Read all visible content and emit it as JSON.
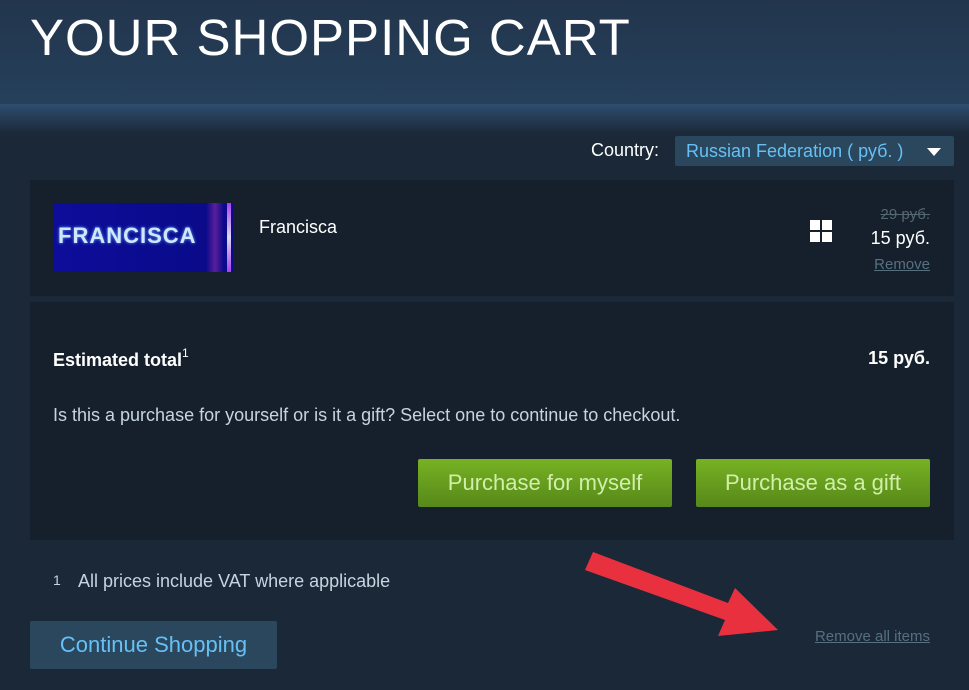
{
  "page": {
    "title": "YOUR SHOPPING CART"
  },
  "country": {
    "label": "Country:",
    "selected": "Russian Federation ( руб. )"
  },
  "cart": {
    "items": [
      {
        "capsule_text": "FRANCISCA",
        "name": "Francisca",
        "platform_icon": "windows-icon",
        "original_price": "29 руб.",
        "final_price": "15 руб.",
        "remove_label": "Remove"
      }
    ]
  },
  "summary": {
    "total_label": "Estimated total",
    "total_footnote": "1",
    "total_value": "15 руб.",
    "question": "Is this a purchase for yourself or is it a gift? Select one to continue to checkout.",
    "purchase_myself": "Purchase for myself",
    "purchase_gift": "Purchase as a gift"
  },
  "footer": {
    "vat_number": "1",
    "vat_note": "All prices include VAT where applicable",
    "continue_shopping": "Continue Shopping",
    "remove_all": "Remove all items"
  },
  "colors": {
    "background": "#1b2838",
    "panel": "#16202d",
    "accent_blue": "#66c0f4",
    "purchase_green": "#75b022",
    "annotation_arrow": "#e8303f"
  }
}
